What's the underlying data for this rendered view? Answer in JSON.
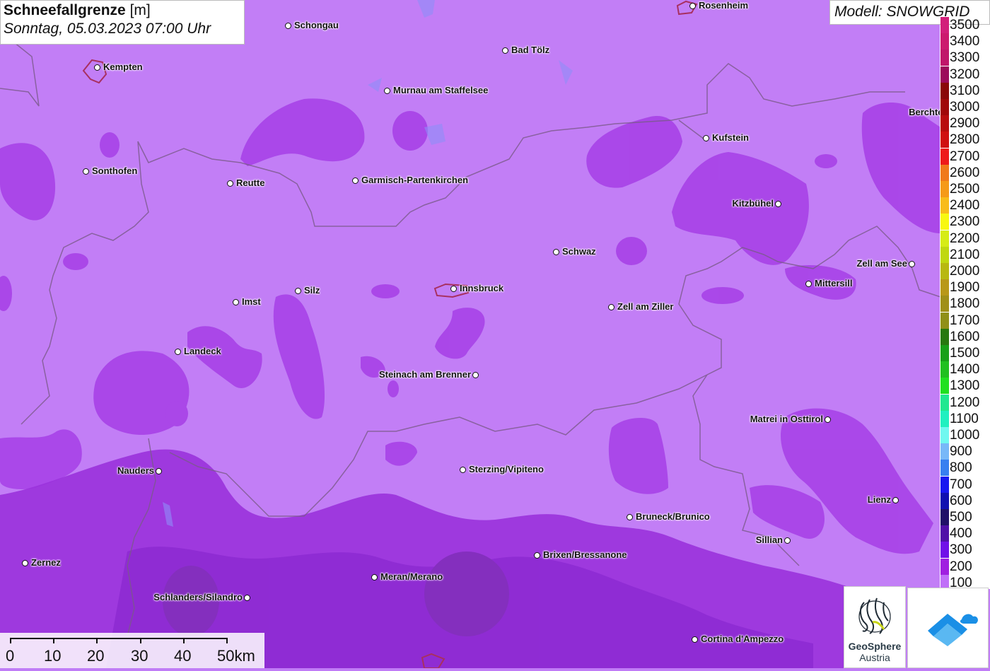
{
  "title": {
    "parameter": "Schneefallgrenze",
    "unit": "[m]",
    "datetime": "Sonntag, 05.03.2023 07:00 Uhr"
  },
  "model_label": "Modell: SNOWGRID",
  "legend": [
    {
      "label": "3500",
      "color": "#d21f7a"
    },
    {
      "label": "3400",
      "color": "#cc1a6e"
    },
    {
      "label": "3300",
      "color": "#c0176a"
    },
    {
      "label": "3200",
      "color": "#9c0b5a"
    },
    {
      "label": "3100",
      "color": "#8a0808"
    },
    {
      "label": "3000",
      "color": "#a00808"
    },
    {
      "label": "2900",
      "color": "#b80d0d"
    },
    {
      "label": "2800",
      "color": "#d01010"
    },
    {
      "label": "2700",
      "color": "#ee1a1a"
    },
    {
      "label": "2600",
      "color": "#f07a1a"
    },
    {
      "label": "2500",
      "color": "#f59a18"
    },
    {
      "label": "2400",
      "color": "#f8bc1a"
    },
    {
      "label": "2300",
      "color": "#f8f810"
    },
    {
      "label": "2200",
      "color": "#d6ec16"
    },
    {
      "label": "2100",
      "color": "#c0d810"
    },
    {
      "label": "2000",
      "color": "#b8b810"
    },
    {
      "label": "1900",
      "color": "#b89818"
    },
    {
      "label": "1800",
      "color": "#a09018"
    },
    {
      "label": "1700",
      "color": "#909018"
    },
    {
      "label": "1600",
      "color": "#28780e"
    },
    {
      "label": "1500",
      "color": "#18a018"
    },
    {
      "label": "1400",
      "color": "#20c020"
    },
    {
      "label": "1300",
      "color": "#20e020"
    },
    {
      "label": "1200",
      "color": "#20e890"
    },
    {
      "label": "1100",
      "color": "#20f0c0"
    },
    {
      "label": "1000",
      "color": "#70f8f0"
    },
    {
      "label": "900",
      "color": "#78b8f8"
    },
    {
      "label": "800",
      "color": "#3880f0"
    },
    {
      "label": "700",
      "color": "#1818f0"
    },
    {
      "label": "600",
      "color": "#1010b0"
    },
    {
      "label": "500",
      "color": "#201068"
    },
    {
      "label": "400",
      "color": "#5010a8"
    },
    {
      "label": "300",
      "color": "#7010e8"
    },
    {
      "label": "200",
      "color": "#a020e0"
    },
    {
      "label": "100",
      "color": "#c070f8"
    }
  ],
  "scale_bar": {
    "labels": [
      "0",
      "10",
      "20",
      "30",
      "40",
      "50km"
    ]
  },
  "logos": {
    "geosphere_name": "GeoSphere",
    "geosphere_sub": "Austria"
  },
  "cities": [
    {
      "name": "Rosenheim",
      "side": "right"
    },
    {
      "name": "Schongau",
      "side": "right"
    },
    {
      "name": "Kempten",
      "side": "right"
    },
    {
      "name": "Bad Tölz",
      "side": "right"
    },
    {
      "name": "Murnau am Staffelsee",
      "side": "right"
    },
    {
      "name": "Berchtesgaden",
      "side": "left"
    },
    {
      "name": "Kufstein",
      "side": "right"
    },
    {
      "name": "Sonthofen",
      "side": "right"
    },
    {
      "name": "Reutte",
      "side": "right"
    },
    {
      "name": "Garmisch-Partenkirchen",
      "side": "right"
    },
    {
      "name": "Kitzbühel",
      "side": "left"
    },
    {
      "name": "Schwaz",
      "side": "right"
    },
    {
      "name": "Zell am See",
      "side": "left"
    },
    {
      "name": "Mittersill",
      "side": "right"
    },
    {
      "name": "Silz",
      "side": "right"
    },
    {
      "name": "Innsbruck",
      "side": "right"
    },
    {
      "name": "Imst",
      "side": "right"
    },
    {
      "name": "Zell am Ziller",
      "side": "right"
    },
    {
      "name": "Landeck",
      "side": "right"
    },
    {
      "name": "Steinach am Brenner",
      "side": "left"
    },
    {
      "name": "Matrei in Osttirol",
      "side": "left"
    },
    {
      "name": "Nauders",
      "side": "left"
    },
    {
      "name": "Sterzing/Vipiteno",
      "side": "right"
    },
    {
      "name": "Lienz",
      "side": "left"
    },
    {
      "name": "Bruneck/Brunico",
      "side": "right"
    },
    {
      "name": "Sillian",
      "side": "left"
    },
    {
      "name": "Brixen/Bressanone",
      "side": "right"
    },
    {
      "name": "Zernez",
      "side": "right"
    },
    {
      "name": "Meran/Merano",
      "side": "right"
    },
    {
      "name": "Schlanders/Silandro",
      "side": "left"
    },
    {
      "name": "Cortina d'Ampezzo",
      "side": "right"
    }
  ]
}
